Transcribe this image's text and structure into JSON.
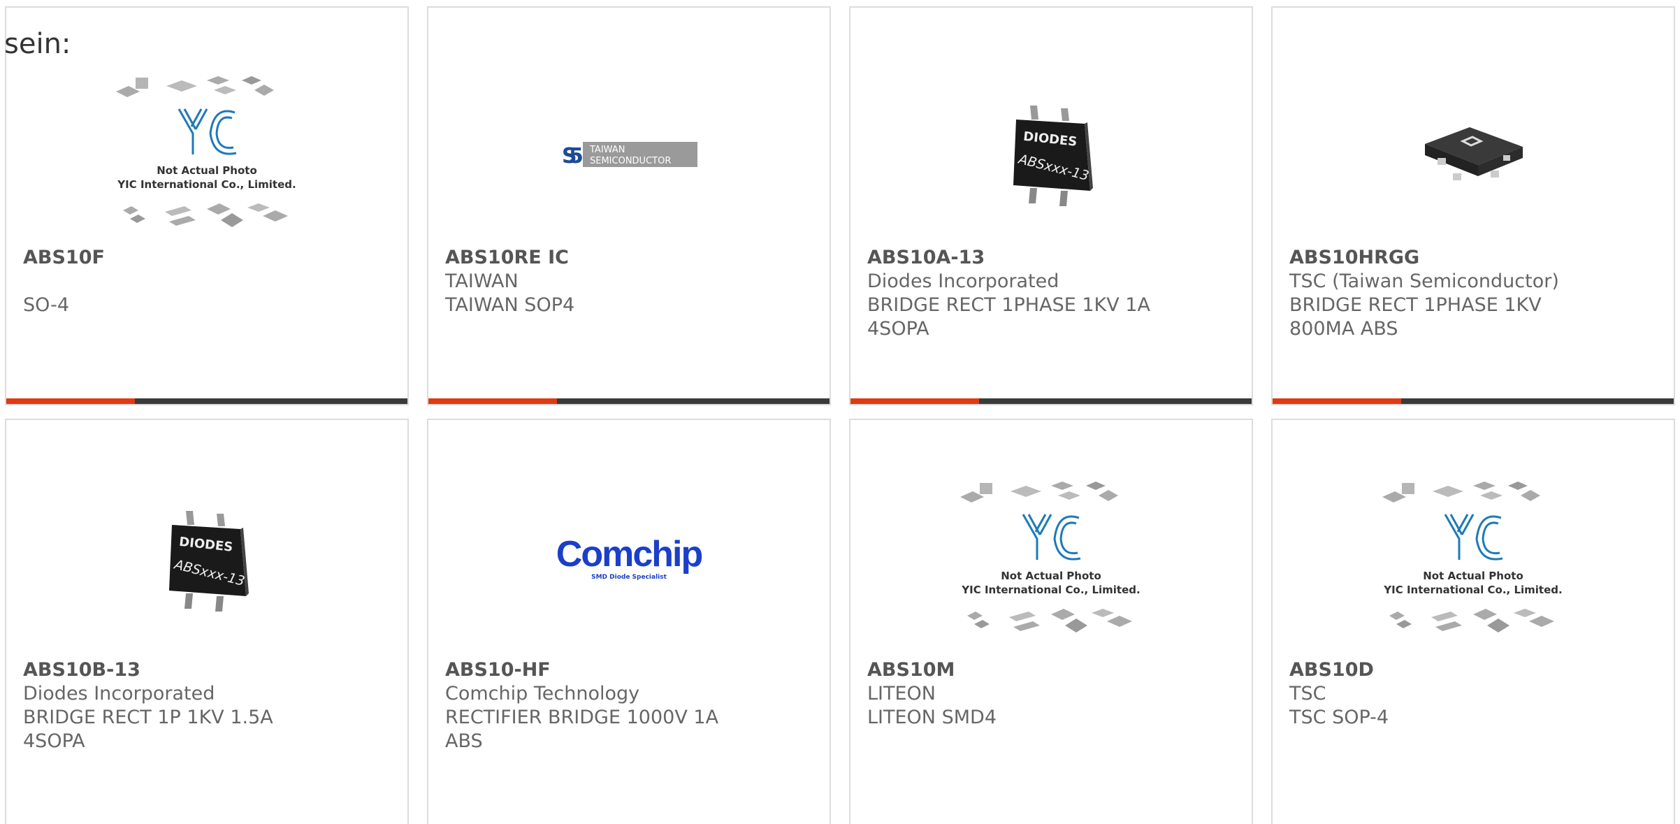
{
  "lead_text": "sein:",
  "colors": {
    "accent": "#e03a12",
    "bar": "#3a3a3a",
    "border": "#dcdcdc"
  },
  "placeholder": {
    "line1": "Not Actual Photo",
    "line2": "YIC International Co., Limited.",
    "logo": "YIC"
  },
  "logos": {
    "taiwan_line1": "TAIWAN",
    "taiwan_line2": "SEMICONDUCTOR",
    "diodes_brand": "DIODES",
    "diodes_part": "ABSxxx-13",
    "comchip_brand": "Comchip",
    "comchip_tag": "SMD Diode Specialist"
  },
  "products": [
    {
      "part": "ABS10F",
      "maker": "",
      "desc1": "SO-4",
      "desc2": "",
      "image": "yic-placeholder"
    },
    {
      "part": "ABS10RE IC",
      "maker": "TAIWAN",
      "desc1": "TAIWAN SOP4",
      "desc2": "",
      "image": "taiwan-semiconductor-logo"
    },
    {
      "part": "ABS10A-13",
      "maker": "Diodes Incorporated",
      "desc1": "BRIDGE RECT 1PHASE 1KV 1A",
      "desc2": "4SOPA",
      "image": "diodes-chip"
    },
    {
      "part": "ABS10HRGG",
      "maker": "TSC (Taiwan Semiconductor)",
      "desc1": "BRIDGE RECT 1PHASE 1KV",
      "desc2": "800MA ABS",
      "image": "tsc-chip"
    },
    {
      "part": "ABS10B-13",
      "maker": "Diodes Incorporated",
      "desc1": "BRIDGE RECT 1P 1KV 1.5A",
      "desc2": "4SOPA",
      "image": "diodes-chip"
    },
    {
      "part": "ABS10-HF",
      "maker": "Comchip Technology",
      "desc1": "RECTIFIER BRIDGE 1000V 1A",
      "desc2": "ABS",
      "image": "comchip-logo"
    },
    {
      "part": "ABS10M",
      "maker": "LITEON",
      "desc1": "LITEON SMD4",
      "desc2": "",
      "image": "yic-placeholder"
    },
    {
      "part": "ABS10D",
      "maker": "TSC",
      "desc1": "TSC SOP-4",
      "desc2": "",
      "image": "yic-placeholder"
    }
  ]
}
